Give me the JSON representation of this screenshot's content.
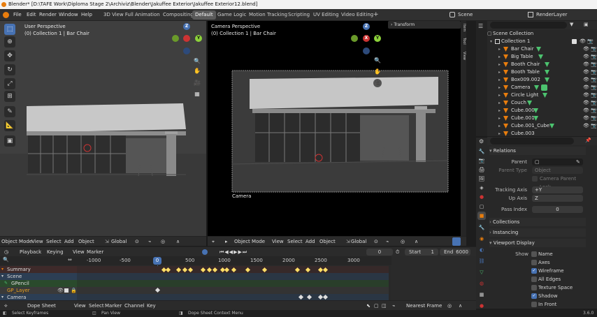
{
  "window_title": "Blender* [D:\\TAFE Work\\Diploma Stage 2\\Archiviz\\Blender\\Jakuffee Exterior\\Jakuffee Exterior12.blend]",
  "menu": [
    "File",
    "Edit",
    "Render",
    "Window",
    "Help"
  ],
  "workspaces": [
    "3D View Full",
    "Animation",
    "Compositing",
    "Default",
    "Game Logic",
    "Motion Tracking",
    "Scripting",
    "UV Editing",
    "Video Editing"
  ],
  "active_workspace": "Default",
  "scene_name": "Scene",
  "view_layer": "RenderLayer",
  "left_viewport": {
    "title": "User Perspective",
    "subtitle": "(0) Collection 1 | Bar Chair"
  },
  "right_viewport": {
    "title": "Camera Perspective",
    "subtitle": "(0) Collection 1 | Bar Chair",
    "camera_label": "Camera",
    "transform_label": "Transform"
  },
  "sidebar_tabs": [
    "Item",
    "Tool",
    "View"
  ],
  "gizmo": {
    "z": "Z",
    "y": "Y",
    "x": "X"
  },
  "left_header": [
    "Object Mode",
    "View",
    "Select",
    "Add",
    "Object",
    "Global"
  ],
  "right_header": [
    "Object Mode",
    "View",
    "Select",
    "Add",
    "Object",
    "Global"
  ],
  "outliner": {
    "root": "Scene Collection",
    "collection": "Collection 1",
    "items": [
      "Bar Chair",
      "Big Table",
      "Booth Chair",
      "Booth Table",
      "Box009.002",
      "Camera",
      "Circle Light",
      "Couch",
      "Cube.000",
      "Cube.001",
      "Cube.001_Cube",
      "Cube.003"
    ]
  },
  "properties": {
    "relations_title": "Relations",
    "parent_label": "Parent",
    "parent_type_label": "Parent Type",
    "parent_type_value": "Object",
    "camera_parent_lock": "Camera Parent Lock",
    "tracking_axis_label": "Tracking Axis",
    "tracking_axis_value": "+Y",
    "up_axis_label": "Up Axis",
    "up_axis_value": "Z",
    "pass_index_label": "Pass Index",
    "pass_index_value": "0",
    "collections": "Collections",
    "instancing": "Instancing",
    "viewport_display": "Viewport Display",
    "show_label": "Show",
    "show_items": [
      {
        "label": "Name",
        "checked": false
      },
      {
        "label": "Axes",
        "checked": false
      },
      {
        "label": "Wireframe",
        "checked": true
      },
      {
        "label": "All Edges",
        "checked": false
      },
      {
        "label": "Texture Space",
        "checked": false
      },
      {
        "label": "Shadow",
        "checked": true
      },
      {
        "label": "In Front",
        "checked": false
      }
    ]
  },
  "timeline": {
    "menus": [
      "Playback",
      "Keying",
      "View",
      "Marker"
    ],
    "current_frame": "0",
    "start_label": "Start",
    "start_value": "1",
    "end_label": "End",
    "end_value": "6000",
    "ruler": [
      "-1000",
      "-500",
      "0",
      "500",
      "1000",
      "1500",
      "2000",
      "2500",
      "3000"
    ],
    "channels": [
      "Summary",
      "Scene",
      "GPencil",
      "GP_Layer",
      "Camera"
    ]
  },
  "dopesheet_header": {
    "mode": "Dope Sheet",
    "menus": [
      "View",
      "Select",
      "Marker",
      "Channel",
      "Key"
    ],
    "snap": "Nearest Frame"
  },
  "status": {
    "left": "Select Keyframes",
    "middle1": "Pan View",
    "middle2": "Dope Sheet Context Menu",
    "version": "3.6.0"
  }
}
